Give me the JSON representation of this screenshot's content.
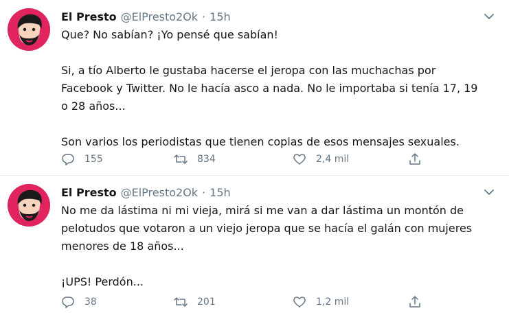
{
  "colors": {
    "accent_avatar": "#e0245e",
    "secondary_text": "#657786",
    "primary_text": "#14171a",
    "divider": "#e6ecf0"
  },
  "tweets": [
    {
      "author": {
        "name": "El Presto",
        "handle": "@ElPresto2Ok",
        "separator": "·",
        "time": "15h"
      },
      "paragraphs": [
        "Que? No sabían? ¡Yo pensé que sabían!",
        "Si, a tío Alberto le gustaba hacerse el jeropa con las muchachas por Facebook y Twitter. No le hacía asco a nada. No le importaba si tenía 17, 19 o 28 años...",
        "Son varios los periodistas que tienen copias de esos mensajes sexuales."
      ],
      "stats": {
        "replies": "155",
        "retweets": "834",
        "likes": "2,4 mil"
      },
      "icons": {
        "reply": "reply-icon",
        "retweet": "retweet-icon",
        "like": "heart-icon",
        "share": "share-icon",
        "menu": "chevron-down-icon"
      }
    },
    {
      "author": {
        "name": "El Presto",
        "handle": "@ElPresto2Ok",
        "separator": "·",
        "time": "15h"
      },
      "paragraphs": [
        "No me da lástima ni mi vieja, mirá si me van a dar lástima un montón de pelotudos que votaron a un viejo jeropa que se hacía el galán con mujeres menores de 18 años...",
        "¡UPS! Perdón..."
      ],
      "stats": {
        "replies": "38",
        "retweets": "201",
        "likes": "1,2 mil"
      },
      "icons": {
        "reply": "reply-icon",
        "retweet": "retweet-icon",
        "like": "heart-icon",
        "share": "share-icon",
        "menu": "chevron-down-icon"
      }
    }
  ]
}
